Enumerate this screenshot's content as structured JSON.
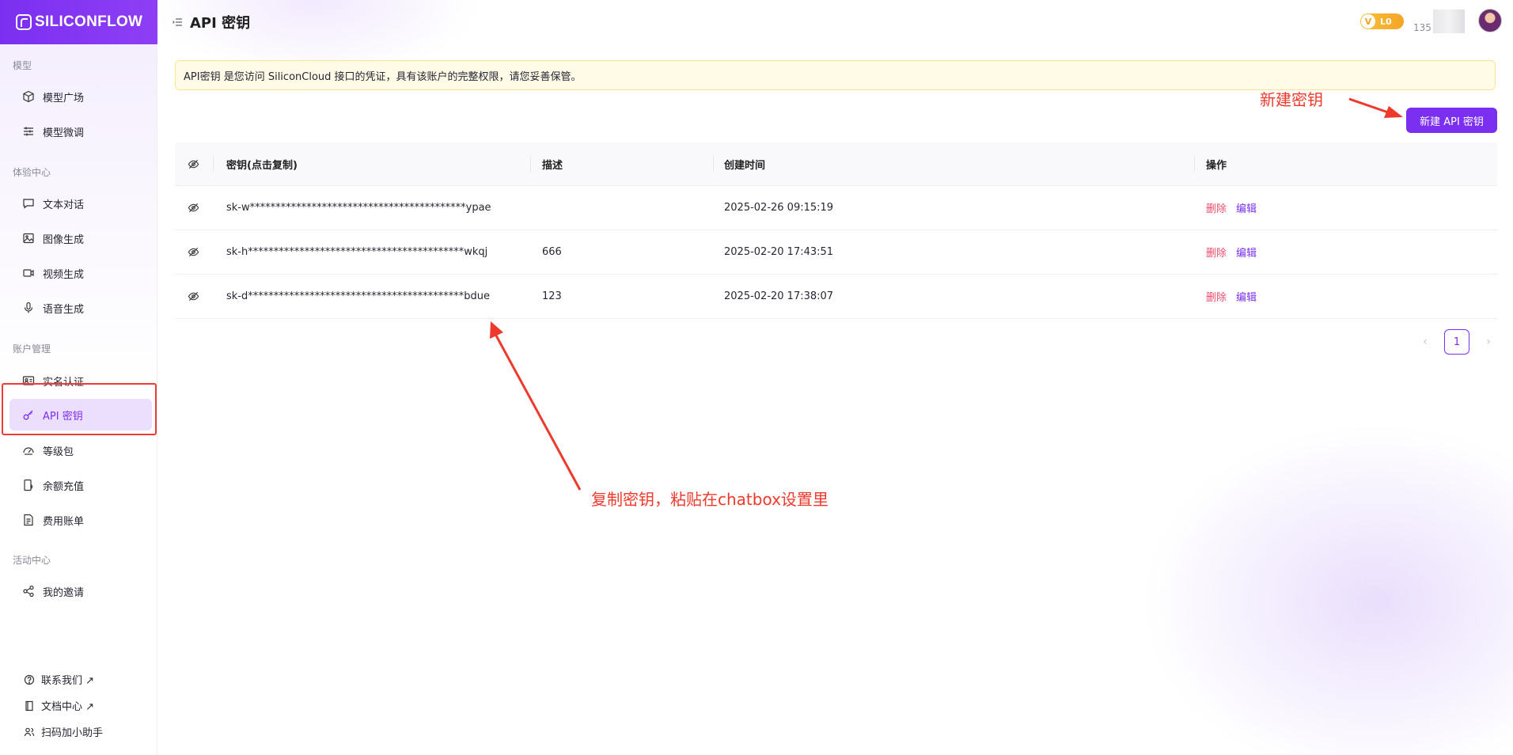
{
  "brand": {
    "name": "SILICONFLOW"
  },
  "sidebar": {
    "sections": [
      {
        "label": "模型",
        "items": [
          {
            "label": "模型广场",
            "icon": "cube-icon"
          },
          {
            "label": "模型微调",
            "icon": "sliders-icon"
          }
        ]
      },
      {
        "label": "体验中心",
        "items": [
          {
            "label": "文本对话",
            "icon": "chat-icon"
          },
          {
            "label": "图像生成",
            "icon": "image-icon"
          },
          {
            "label": "视频生成",
            "icon": "video-icon"
          },
          {
            "label": "语音生成",
            "icon": "mic-icon"
          }
        ]
      },
      {
        "label": "账户管理",
        "items": [
          {
            "label": "实名认证",
            "icon": "id-card-icon"
          },
          {
            "label": "API 密钥",
            "icon": "key-icon",
            "active": true
          },
          {
            "label": "等级包",
            "icon": "gauge-icon"
          },
          {
            "label": "余额充值",
            "icon": "recharge-icon"
          },
          {
            "label": "费用账单",
            "icon": "bill-icon"
          }
        ]
      },
      {
        "label": "活动中心",
        "items": [
          {
            "label": "我的邀请",
            "icon": "share-icon"
          }
        ]
      }
    ],
    "footer": [
      {
        "label": "联系我们 ↗",
        "icon": "help-icon"
      },
      {
        "label": "文档中心 ↗",
        "icon": "book-icon"
      },
      {
        "label": "扫码加小助手",
        "icon": "people-icon"
      }
    ]
  },
  "header": {
    "title": "API 密钥",
    "level": "L0",
    "level_icon": "V",
    "phone_partial": "135"
  },
  "notice": "API密钥 是您访问 SiliconCloud 接口的凭证，具有该账户的完整权限，请您妥善保管。",
  "new_key_button": "新建 API 密钥",
  "annotations": {
    "new_key": "新建密钥",
    "copy_key": "复制密钥，粘贴在chatbox设置里"
  },
  "table": {
    "columns": {
      "key": "密钥(点击复制)",
      "desc": "描述",
      "created": "创建时间",
      "ops": "操作"
    },
    "rows": [
      {
        "key": "sk-w******************************************ypae",
        "desc": "",
        "created": "2025-02-26 09:15:19"
      },
      {
        "key": "sk-h******************************************wkqj",
        "desc": "666",
        "created": "2025-02-20 17:43:51"
      },
      {
        "key": "sk-d******************************************bdue",
        "desc": "123",
        "created": "2025-02-20 17:38:07"
      }
    ],
    "op_delete": "删除",
    "op_edit": "编辑"
  },
  "pagination": {
    "current": "1",
    "prev": "‹",
    "next": "›"
  },
  "colors": {
    "accent": "#7b2ff0",
    "annotation": "#ee3a2c",
    "danger": "#ef4d6c"
  }
}
